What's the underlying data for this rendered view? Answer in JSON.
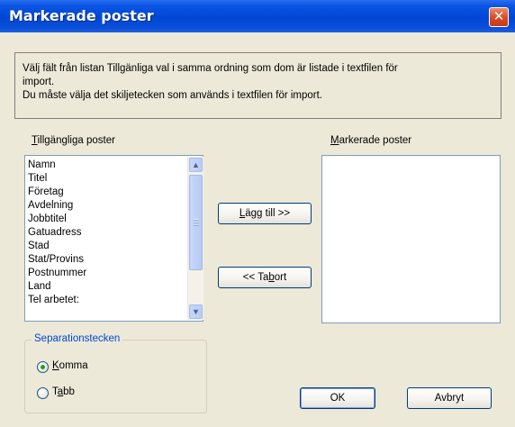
{
  "window": {
    "title": "Markerade poster",
    "close_glyph": "✕"
  },
  "instructions": {
    "line1": "Välj fält från listan Tillgänliga val i samma ordning som dom är listade i textfilen för",
    "line2": "import.",
    "line3": "Du måste välja det skiljetecken som används i textfilen för import."
  },
  "available": {
    "label_mnemonic": "T",
    "label_rest": "illgängliga poster",
    "items": [
      "Namn",
      "Titel",
      "Företag",
      "Avdelning",
      "Jobbtitel",
      "Gatuadress",
      "Stad",
      "Stat/Provins",
      "Postnummer",
      "Land",
      "Tel arbetet:"
    ]
  },
  "selected": {
    "label_mnemonic": "M",
    "label_rest": "arkerade poster",
    "items": []
  },
  "buttons": {
    "add_mnemonic": "L",
    "add_rest": "ägg till >>",
    "remove_prefix": "<< Ta ",
    "remove_mnemonic": "b",
    "remove_rest": "ort",
    "ok": "OK",
    "cancel": "Avbryt"
  },
  "separator": {
    "legend": "Separationstecken",
    "options": [
      {
        "mnemonic": "K",
        "rest": "omma",
        "selected": true
      },
      {
        "prefix": "T",
        "mnemonic": "a",
        "rest": "bb",
        "selected": false
      }
    ]
  },
  "scroll": {
    "up_glyph": "▲",
    "down_glyph": "▼"
  }
}
